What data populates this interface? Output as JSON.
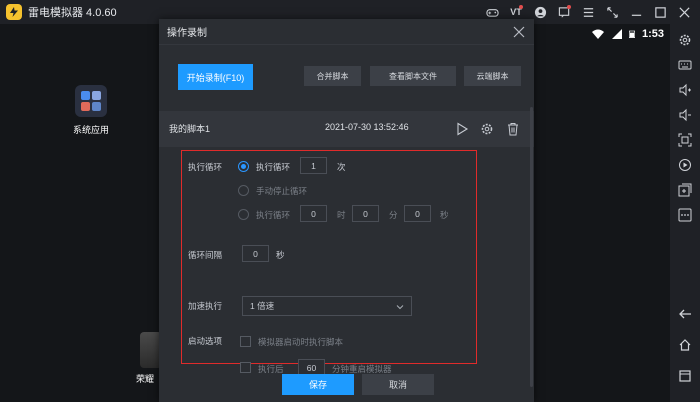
{
  "app": {
    "title": "雷电模拟器 4.0.60"
  },
  "titlebar_icons": [
    "gamepad-icon",
    "vt-icon",
    "user-icon",
    "message-icon",
    "menu-icon",
    "restore-icon",
    "minimize-icon",
    "maximize-icon",
    "close-icon"
  ],
  "titlebar_vt_label": "VT",
  "status": {
    "time": "1:53"
  },
  "desktop": {
    "system_apps_label": "系统应用",
    "game_label": "荣耀"
  },
  "dialog": {
    "title": "操作录制",
    "record_button": "开始录制(F10)",
    "merge_button": "合并脚本",
    "view_files_button": "查看脚本文件",
    "cloud_button": "云端脚本",
    "script": {
      "name": "我的脚本1",
      "timestamp": "2021-07-30 13:52:46"
    },
    "settings": {
      "loop_label": "执行循环",
      "loop_option_count": "执行循环",
      "loop_count_value": "1",
      "loop_count_unit": "次",
      "manual_stop_label": "手动停止循环",
      "timed_loop_label": "执行循环",
      "timed_hours": "0",
      "unit_hours": "时",
      "timed_minutes": "0",
      "unit_minutes": "分",
      "timed_seconds": "0",
      "unit_seconds": "秒",
      "interval_label": "循环间隔",
      "interval_value": "0",
      "interval_unit": "秒",
      "speed_label": "加速执行",
      "speed_value": "1 倍速",
      "startup_label": "启动选项",
      "startup_option": "模拟器启动时执行脚本",
      "restart_prefix": "执行后",
      "restart_minutes": "60",
      "restart_suffix": "分钟重启模拟器"
    },
    "save_button": "保存",
    "cancel_button": "取消"
  },
  "colors": {
    "accent": "#1e9bff",
    "highlight_border": "#e02b2b",
    "dialog_bg": "#2b2e33"
  }
}
